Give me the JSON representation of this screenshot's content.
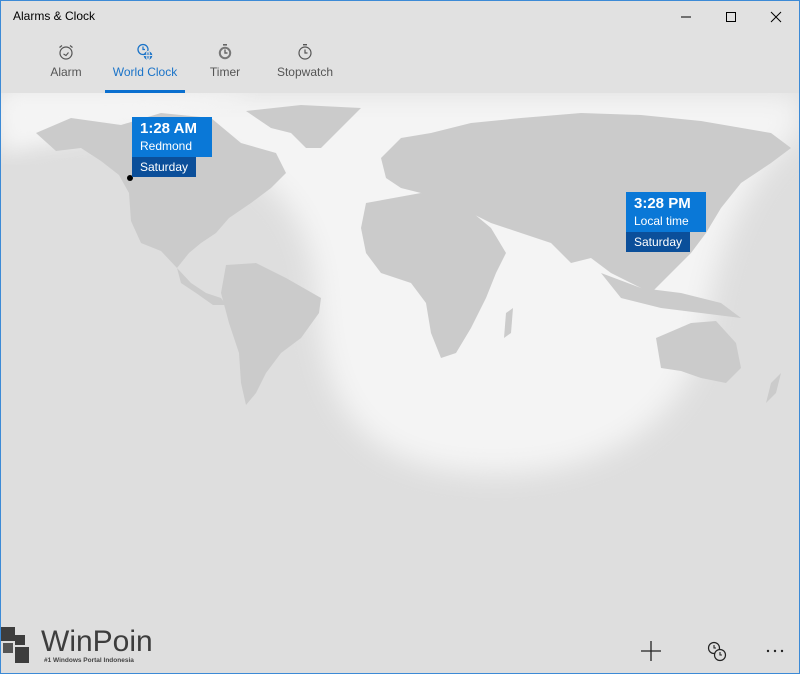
{
  "window": {
    "title": "Alarms & Clock",
    "controls": {
      "minimize": "minimize-icon",
      "maximize": "maximize-icon",
      "close": "close-icon"
    }
  },
  "tabs": [
    {
      "label": "Alarm",
      "icon": "alarm-clock-icon",
      "active": false
    },
    {
      "label": "World Clock",
      "icon": "world-clock-icon",
      "active": true
    },
    {
      "label": "Timer",
      "icon": "timer-icon",
      "active": false
    },
    {
      "label": "Stopwatch",
      "icon": "stopwatch-icon",
      "active": false
    }
  ],
  "clocks": [
    {
      "time": "1:28 AM",
      "place": "Redmond",
      "day": "Saturday"
    },
    {
      "time": "3:28 PM",
      "place": "Local time",
      "day": "Saturday"
    }
  ],
  "colors": {
    "accent": "#0a78d7",
    "accent_dark": "#0b4f9a",
    "tab_active": "#1a73c8",
    "map_night": "#dedede",
    "map_day": "#f2f2f2",
    "land": "#cfcfcf"
  },
  "bottom_bar": {
    "add": "add-icon",
    "compare": "compare-clocks-icon",
    "more": "more-icon"
  },
  "watermark": {
    "name": "WinPoin",
    "tagline": "#1 Windows Portal Indonesia"
  }
}
